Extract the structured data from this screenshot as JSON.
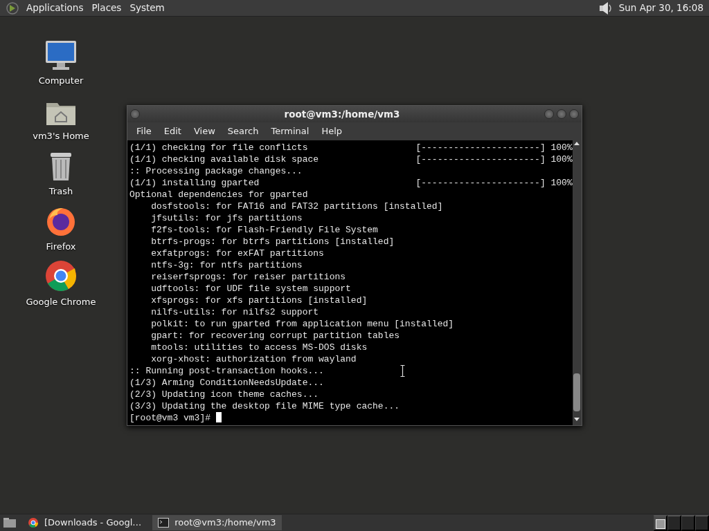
{
  "top_panel": {
    "menus": [
      "Applications",
      "Places",
      "System"
    ],
    "clock": "Sun Apr 30, 16:08"
  },
  "desktop_icons": [
    {
      "label": "Computer",
      "kind": "computer"
    },
    {
      "label": "vm3's Home",
      "kind": "home"
    },
    {
      "label": "Trash",
      "kind": "trash"
    },
    {
      "label": "Firefox",
      "kind": "firefox"
    },
    {
      "label": "Google Chrome",
      "kind": "chrome"
    }
  ],
  "terminal": {
    "title": "root@vm3:/home/vm3",
    "menus": [
      "File",
      "Edit",
      "View",
      "Search",
      "Terminal",
      "Help"
    ],
    "lines": [
      {
        "text": "(1/1) checking for file conflicts",
        "progress": "[----------------------] 100%"
      },
      {
        "text": "(1/1) checking available disk space",
        "progress": "[----------------------] 100%"
      },
      {
        "text": ":: Processing package changes..."
      },
      {
        "text": "(1/1) installing gparted",
        "progress": "[----------------------] 100%"
      },
      {
        "text": "Optional dependencies for gparted"
      },
      {
        "text": "    dosfstools: for FAT16 and FAT32 partitions [installed]"
      },
      {
        "text": "    jfsutils: for jfs partitions"
      },
      {
        "text": "    f2fs-tools: for Flash-Friendly File System"
      },
      {
        "text": "    btrfs-progs: for btrfs partitions [installed]"
      },
      {
        "text": "    exfatprogs: for exFAT partitions"
      },
      {
        "text": "    ntfs-3g: for ntfs partitions"
      },
      {
        "text": "    reiserfsprogs: for reiser partitions"
      },
      {
        "text": "    udftools: for UDF file system support"
      },
      {
        "text": "    xfsprogs: for xfs partitions [installed]"
      },
      {
        "text": "    nilfs-utils: for nilfs2 support"
      },
      {
        "text": "    polkit: to run gparted from application menu [installed]"
      },
      {
        "text": "    gpart: for recovering corrupt partition tables"
      },
      {
        "text": "    mtools: utilities to access MS-DOS disks"
      },
      {
        "text": "    xorg-xhost: authorization from wayland"
      },
      {
        "text": ":: Running post-transaction hooks..."
      },
      {
        "text": "(1/3) Arming ConditionNeedsUpdate..."
      },
      {
        "text": "(2/3) Updating icon theme caches..."
      },
      {
        "text": "(3/3) Updating the desktop file MIME type cache..."
      }
    ],
    "prompt": "[root@vm3 vm3]#"
  },
  "taskbar": {
    "items": [
      {
        "label": "[Downloads - Googl…",
        "kind": "chrome",
        "selected": false
      },
      {
        "label": "root@vm3:/home/vm3",
        "kind": "terminal",
        "selected": true
      }
    ],
    "workspaces": [
      {
        "selected": true
      },
      {
        "selected": false
      },
      {
        "selected": false
      },
      {
        "selected": false
      }
    ]
  }
}
